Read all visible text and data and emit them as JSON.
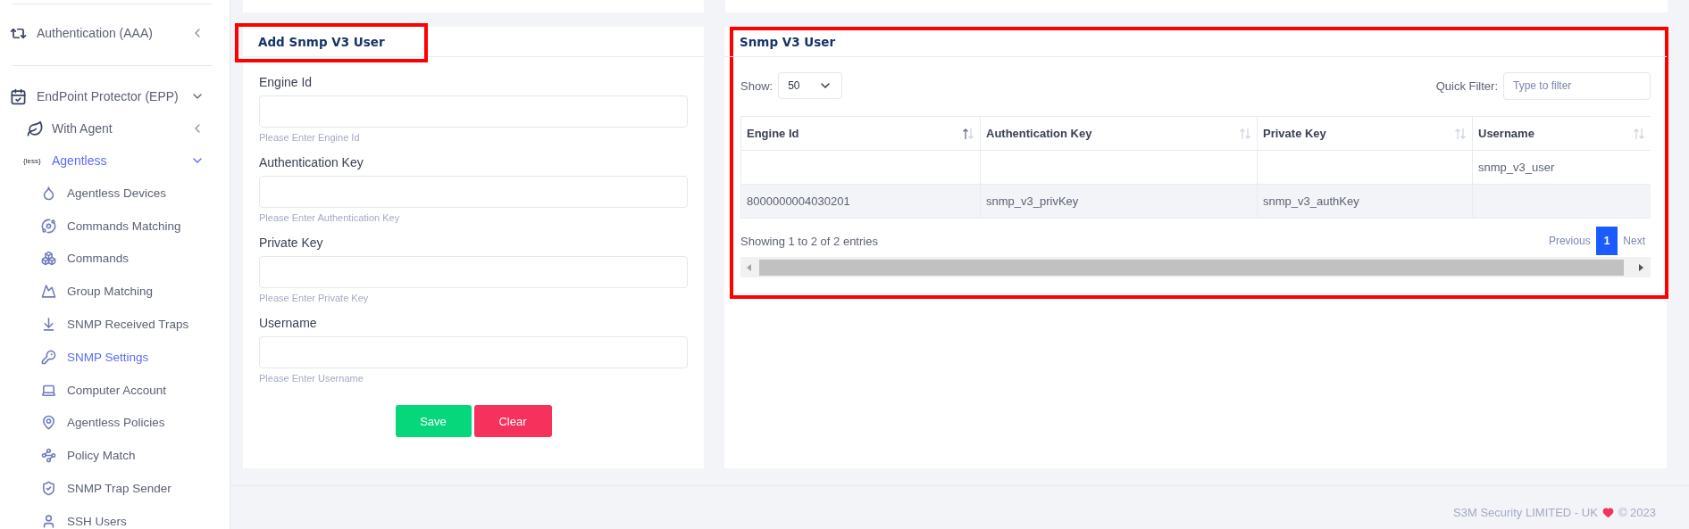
{
  "sidebar": {
    "items": [
      {
        "label": "Authentication (AAA)",
        "expanded": false,
        "selected": false
      },
      {
        "label": "EndPoint Protector (EPP)",
        "expanded": true,
        "selected": false,
        "children": [
          {
            "label": "With Agent",
            "expanded": false,
            "selected": false
          },
          {
            "label": "Agentless",
            "badge": "{less}",
            "expanded": true,
            "selected": true,
            "children": [
              {
                "label": "Agentless Devices",
                "selected": false
              },
              {
                "label": "Commands Matching",
                "selected": false
              },
              {
                "label": "Commands",
                "selected": false
              },
              {
                "label": "Group Matching",
                "selected": false
              },
              {
                "label": "SNMP Received Traps",
                "selected": false
              },
              {
                "label": "SNMP Settings",
                "selected": true
              },
              {
                "label": "Computer Account",
                "selected": false
              },
              {
                "label": "Agentless Policies",
                "selected": false
              },
              {
                "label": "Policy Match",
                "selected": false
              },
              {
                "label": "SNMP Trap Sender",
                "selected": false
              },
              {
                "label": "SSH Users",
                "selected": false
              }
            ]
          }
        ]
      }
    ]
  },
  "form": {
    "title": "Add Snmp V3 User",
    "highlighted": true,
    "fields": [
      {
        "label": "Engine Id",
        "hint": "Please Enter Engine Id"
      },
      {
        "label": "Authentication Key",
        "hint": "Please Enter Authentication Key"
      },
      {
        "label": "Private Key",
        "hint": "Please Enter Private Key"
      },
      {
        "label": "Username",
        "hint": "Please Enter Username"
      }
    ],
    "buttons": [
      {
        "label": "Save",
        "kind": "primary"
      },
      {
        "label": "Clear",
        "kind": "danger"
      }
    ]
  },
  "table_card": {
    "title": "Snmp V3 User",
    "highlighted": true,
    "show_label": "Show:",
    "page_size": "50",
    "filter_label": "Quick Filter:",
    "filter_placeholder": "Type to filter",
    "columns": [
      {
        "label": "Engine Id",
        "sorted": true
      },
      {
        "label": "Authentication Key",
        "sorted": false
      },
      {
        "label": "Private Key",
        "sorted": false
      },
      {
        "label": "Username",
        "sorted": false
      }
    ],
    "rows": [
      {
        "cells": [
          null,
          null,
          null,
          "snmp_v3_user"
        ]
      },
      {
        "cells": [
          "8000000004030201",
          "snmp_v3_privKey",
          "snmp_v3_authKey",
          null
        ]
      }
    ],
    "summary": "Showing 1 to 2 of 2 entries",
    "pagination": [
      {
        "label": "Previous",
        "selected": false
      },
      {
        "label": "1",
        "selected": true
      },
      {
        "label": "Next",
        "selected": false
      }
    ]
  },
  "footer": {
    "company": "S3M Security LIMITED - UK",
    "copyright": "© 2023"
  }
}
